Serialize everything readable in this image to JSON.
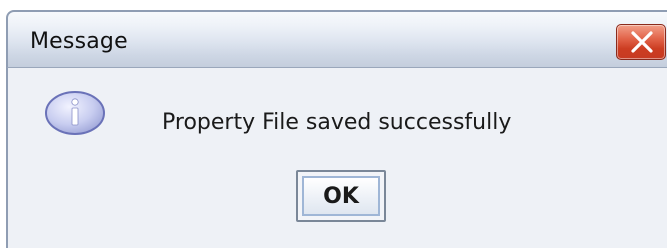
{
  "dialog": {
    "title": "Message",
    "message": "Property File saved successfully",
    "ok_label": "OK",
    "close_icon": "close-icon",
    "message_icon": "info-icon"
  },
  "colors": {
    "titlebar_top": "#f7f9fc",
    "titlebar_bottom": "#c4cedd",
    "close_button": "#cc3d22",
    "content_background": "#eef1f6",
    "info_icon_fill": "#c8cdf0",
    "info_icon_glyph": "#ffffff"
  }
}
